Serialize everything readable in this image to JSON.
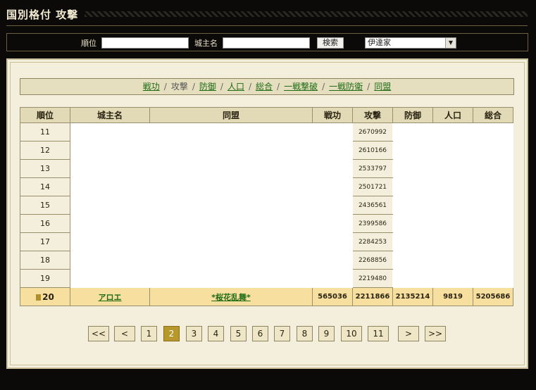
{
  "page": {
    "title": "国別格付 攻撃"
  },
  "search": {
    "rank_label": "順位",
    "rank_value": "",
    "lord_label": "城主名",
    "lord_value": "",
    "button_label": "検索",
    "country_selected": "伊達家"
  },
  "tabs": [
    {
      "label": "戦功",
      "active": false
    },
    {
      "label": "攻撃",
      "active": true
    },
    {
      "label": "防御",
      "active": false
    },
    {
      "label": "人口",
      "active": false
    },
    {
      "label": "総合",
      "active": false
    },
    {
      "label": "一戦撃破",
      "active": false
    },
    {
      "label": "一戦防衛",
      "active": false
    },
    {
      "label": "同盟",
      "active": false
    }
  ],
  "table": {
    "headers": [
      "順位",
      "城主名",
      "同盟",
      "戦功",
      "攻撃",
      "防御",
      "人口",
      "総合"
    ],
    "rows": [
      {
        "rank": "11",
        "attack": "2670992"
      },
      {
        "rank": "12",
        "attack": "2610166"
      },
      {
        "rank": "13",
        "attack": "2533797"
      },
      {
        "rank": "14",
        "attack": "2501721"
      },
      {
        "rank": "15",
        "attack": "2436561"
      },
      {
        "rank": "16",
        "attack": "2399586"
      },
      {
        "rank": "17",
        "attack": "2284253"
      },
      {
        "rank": "18",
        "attack": "2268856"
      },
      {
        "rank": "19",
        "attack": "2219480"
      }
    ],
    "highlight": {
      "rank": "20",
      "lord": "アロエ",
      "alliance": "*桜花乱舞*",
      "merit": "565036",
      "attack": "2211866",
      "defense": "2135214",
      "population": "9819",
      "total": "5205686"
    }
  },
  "pager": {
    "first": "<<",
    "prev": "<",
    "pages": [
      "1",
      "2",
      "3",
      "4",
      "5",
      "6",
      "7",
      "8",
      "9",
      "10",
      "11"
    ],
    "current": "2",
    "next": ">",
    "last": ">>"
  },
  "colors": {
    "accent": "#b8982d",
    "link": "#1e6b14",
    "highlight_row": "#f7dfa0"
  }
}
